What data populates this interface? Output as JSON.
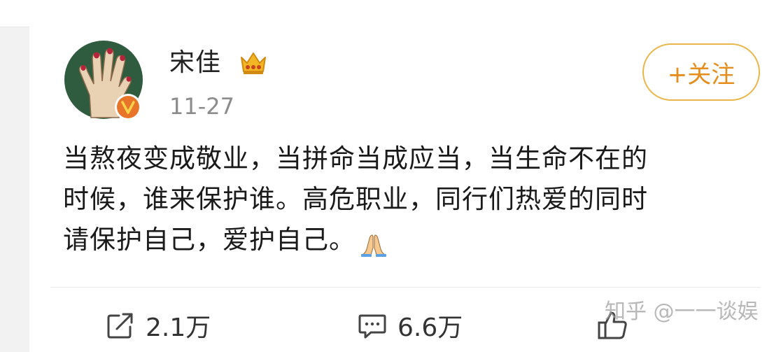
{
  "post": {
    "author": "宋佳",
    "timestamp": "11-27",
    "follow_label": "+关注",
    "lines": [
      "当熬夜变成敬业，当拼命当成应当，当生命不在的",
      "时候，谁来保护谁。高危职业，同行们热爱的同时",
      "请保护自己，爱护自己。"
    ],
    "emoji": "pray-emoji"
  },
  "actions": {
    "share_count": "2.1万",
    "comment_count": "6.6万"
  },
  "watermark": "知乎 @一一谈娱",
  "colors": {
    "accent": "#e58d1d",
    "follow_border": "#e8b64a",
    "avatar_bg": "#2f5b3f",
    "badge": "#e8742a"
  }
}
